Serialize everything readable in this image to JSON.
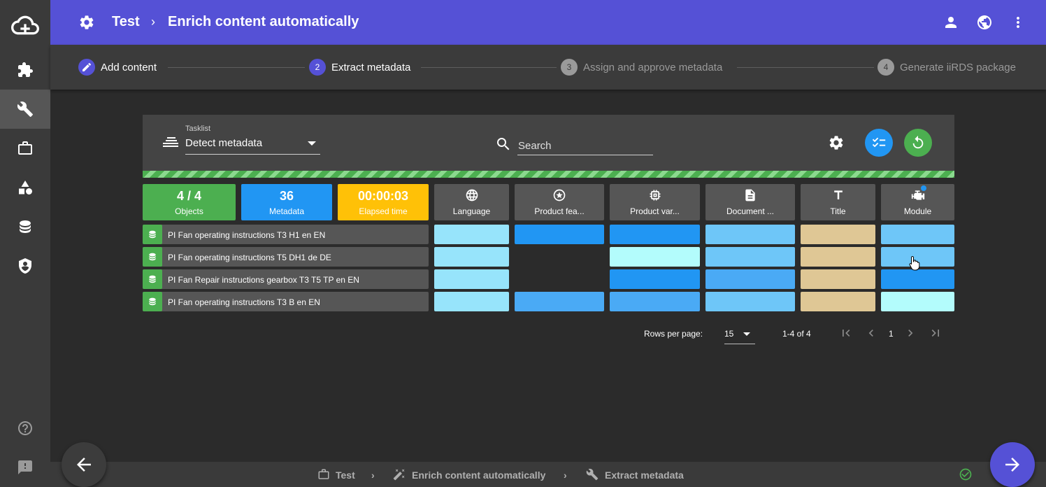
{
  "header": {
    "project": "Test",
    "separator": "›",
    "page_title": "Enrich content automatically"
  },
  "steps": [
    {
      "number": "",
      "label": "Add content",
      "state": "done"
    },
    {
      "number": "2",
      "label": "Extract metadata",
      "state": "active"
    },
    {
      "number": "3",
      "label": "Assign and approve metadata",
      "state": "todo"
    },
    {
      "number": "4",
      "label": "Generate iiRDS package",
      "state": "todo"
    }
  ],
  "toolbar": {
    "tasklist_label": "Tasklist",
    "tasklist_value": "Detect metadata",
    "search_placeholder": "Search"
  },
  "stats": {
    "objects_value": "4 / 4",
    "objects_label": "Objects",
    "metadata_value": "36",
    "metadata_label": "Metadata",
    "elapsed_value": "00:00:03",
    "elapsed_label": "Elapsed time"
  },
  "columns": [
    "Language",
    "Product fea...",
    "Product var...",
    "Document ...",
    "Title",
    "Module"
  ],
  "rows": [
    {
      "name": "PI Fan operating instructions T3 H1 en EN"
    },
    {
      "name": "PI Fan operating instructions T5 DH1 de DE"
    },
    {
      "name": "PI Fan Repair instructions gearbox T3 T5 TP en EN"
    },
    {
      "name": "PI Fan operating instructions T3 B en EN"
    }
  ],
  "cell_colors": [
    [
      "#97e4fb",
      "#2196f3",
      "#2196f3",
      "#6ec6f8",
      "#dfc795",
      "#6ec6f8"
    ],
    [
      "#97e4fb",
      "",
      "#b3fcfc",
      "#6ec6f8",
      "#dfc795",
      "#6ec6f8"
    ],
    [
      "#97e4fb",
      "",
      "#2196f3",
      "#4aaaf5",
      "#dfc795",
      "#2196f3"
    ],
    [
      "#97e4fb",
      "#4aaaf5",
      "#4aaaf5",
      "#6ec6f8",
      "#dfc795",
      "#b3fcfc"
    ]
  ],
  "pagination": {
    "rows_per_page_label": "Rows per page:",
    "rows_per_page_value": "15",
    "range": "1-4 of 4",
    "page": "1"
  },
  "footer": {
    "crumb1": "Test",
    "crumb2": "Enrich content automatically",
    "crumb3": "Extract metadata"
  },
  "colors": {
    "accent": "#5551d6",
    "green": "#4caf50",
    "blue": "#2196f3",
    "amber": "#ffc107"
  }
}
